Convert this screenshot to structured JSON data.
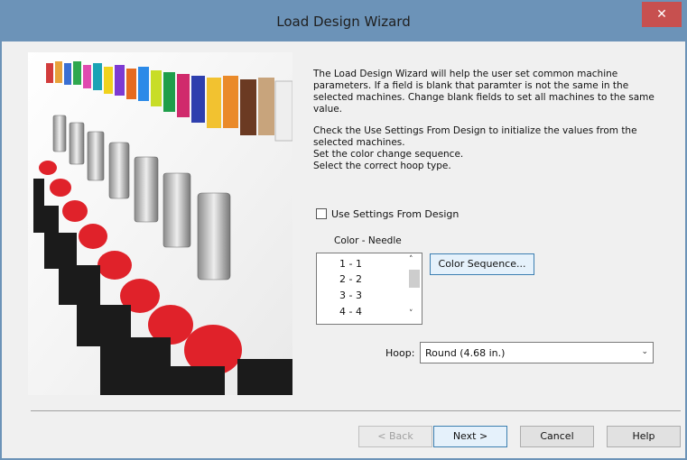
{
  "window": {
    "title": "Load Design Wizard",
    "close_glyph": "✕"
  },
  "intro": {
    "paragraph1": "The Load Design Wizard will help the user set common machine\nparameters. If a field is blank that paramter is not the same in the\nselected machines. Change blank fields to set all machines to the same\nvalue.",
    "paragraph2": "Check the Use Settings From Design to initialize the values from the\nselected machines.\nSet the color change sequence.\nSelect the correct hoop type."
  },
  "use_settings": {
    "label": "Use Settings From Design",
    "checked": false
  },
  "color_needle": {
    "label": "Color - Needle",
    "rows": [
      "1 - 1",
      "2 - 2",
      "3 - 3",
      "4 - 4"
    ]
  },
  "buttons": {
    "color_sequence": "Color Sequence...",
    "back": "< Back",
    "next": "Next >",
    "cancel": "Cancel",
    "help": "Help"
  },
  "hoop": {
    "label": "Hoop:",
    "value": "Round (4.68 in.)"
  },
  "icons": {
    "scroll_up": "˄",
    "scroll_down": "˅",
    "dropdown": "⌄"
  },
  "colors": {
    "title_bar": "#6c93b8",
    "close": "#c7504f",
    "accent_button": "#3c7fb1"
  }
}
